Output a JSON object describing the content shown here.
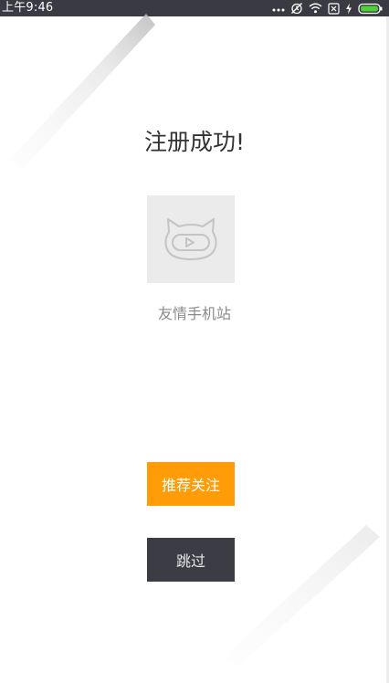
{
  "status_bar": {
    "time": "上午9:46",
    "icons": [
      "more-dots-icon",
      "alarm-off-icon",
      "wifi-icon",
      "sim-off-icon",
      "charging-icon",
      "battery-icon"
    ]
  },
  "main": {
    "title": "注册成功!",
    "app": {
      "icon": "mascot-icon",
      "name": "友情手机站"
    },
    "follow_button": "推荐关注",
    "skip_button": "跳过"
  },
  "colors": {
    "status_bar": "#3a3b42",
    "follow_button": "#ff9c07",
    "skip_button": "#3b3c44",
    "tile": "#ebebeb"
  }
}
